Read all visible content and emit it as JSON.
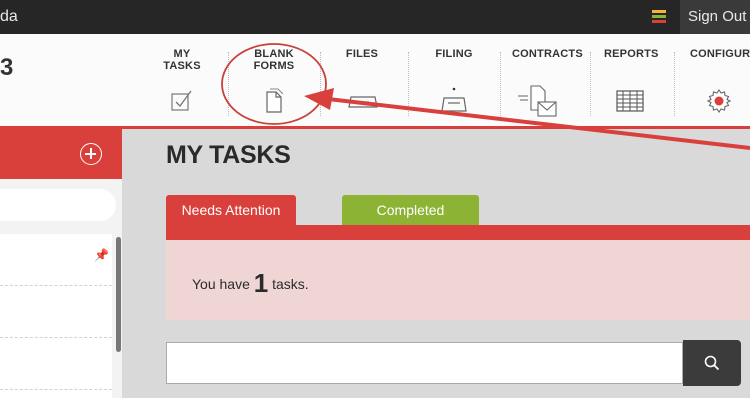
{
  "topbar": {
    "brand_fragment": "da",
    "signout_label": "Sign Out"
  },
  "navbar": {
    "logo_fragment": "3",
    "items": [
      {
        "label": "MY TASKS",
        "icon": "checkbox-icon"
      },
      {
        "label": "BLANK\nFORMS",
        "icon": "document-icon"
      },
      {
        "label": "FILES",
        "icon": "tray-icon"
      },
      {
        "label": "FILING",
        "icon": "inbox-icon"
      },
      {
        "label": "CONTRACTS",
        "icon": "send-document-icon"
      },
      {
        "label": "REPORTS",
        "icon": "table-icon"
      },
      {
        "label": "CONFIGURE",
        "icon": "gear-icon"
      }
    ]
  },
  "main": {
    "title": "MY TASKS",
    "tabs": [
      {
        "label": "Needs Attention",
        "active": true
      },
      {
        "label": "Completed",
        "active": false
      }
    ],
    "status": {
      "prefix": "You have ",
      "count": "1",
      "suffix": " tasks."
    },
    "search": {
      "value": "",
      "placeholder": ""
    }
  },
  "colors": {
    "accent": "#d9403c",
    "completed_tab": "#8db334",
    "panel_bg": "#efd6d5",
    "dark": "#262626"
  }
}
